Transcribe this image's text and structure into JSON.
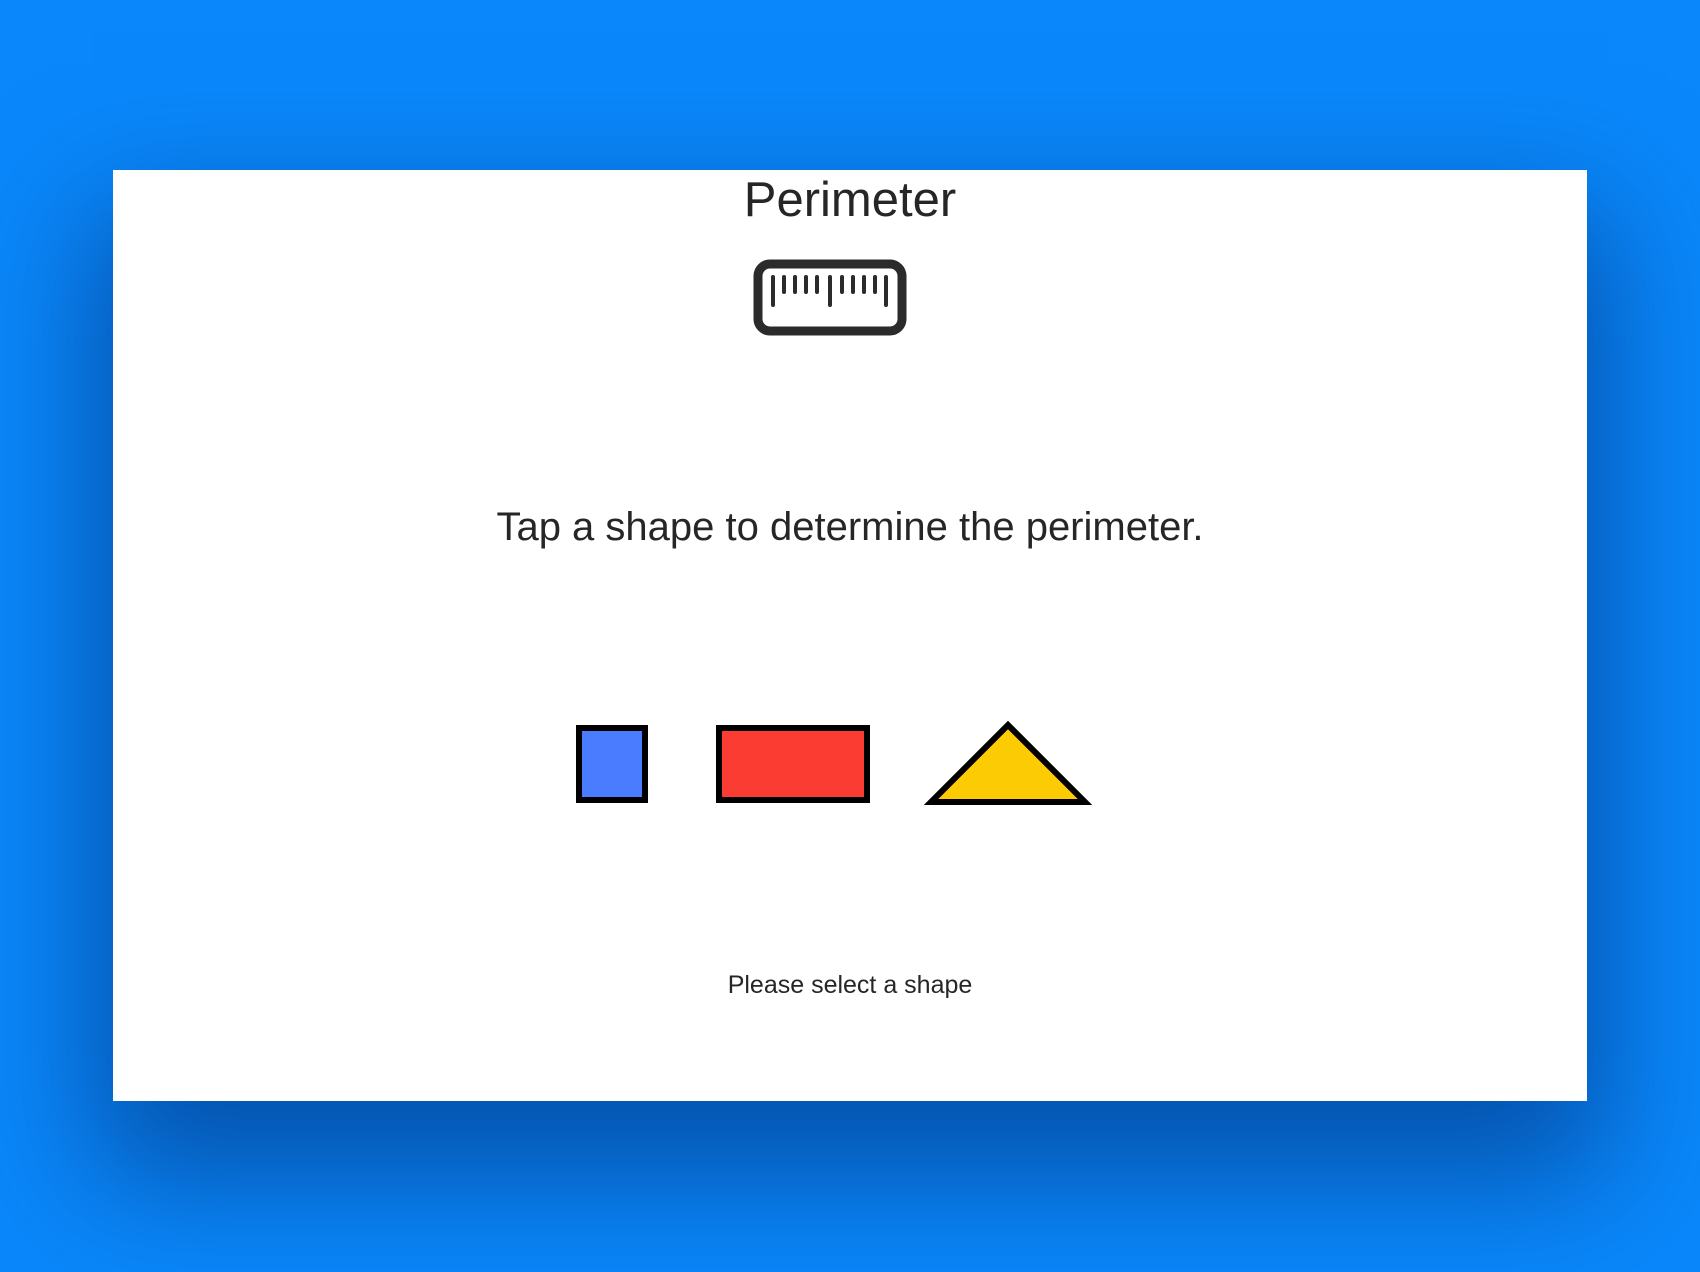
{
  "header": {
    "title": "Perimeter",
    "icon": "ruler-icon"
  },
  "instructions": "Tap a shape to determine the perimeter.",
  "shapes": [
    {
      "name": "square",
      "color": "#4a7cff"
    },
    {
      "name": "rectangle",
      "color": "#fb3c32"
    },
    {
      "name": "triangle",
      "color": "#fccb04"
    }
  ],
  "status": "Please select a shape",
  "colors": {
    "background": "#0a88fb",
    "card": "#ffffff",
    "text": "#262626"
  }
}
